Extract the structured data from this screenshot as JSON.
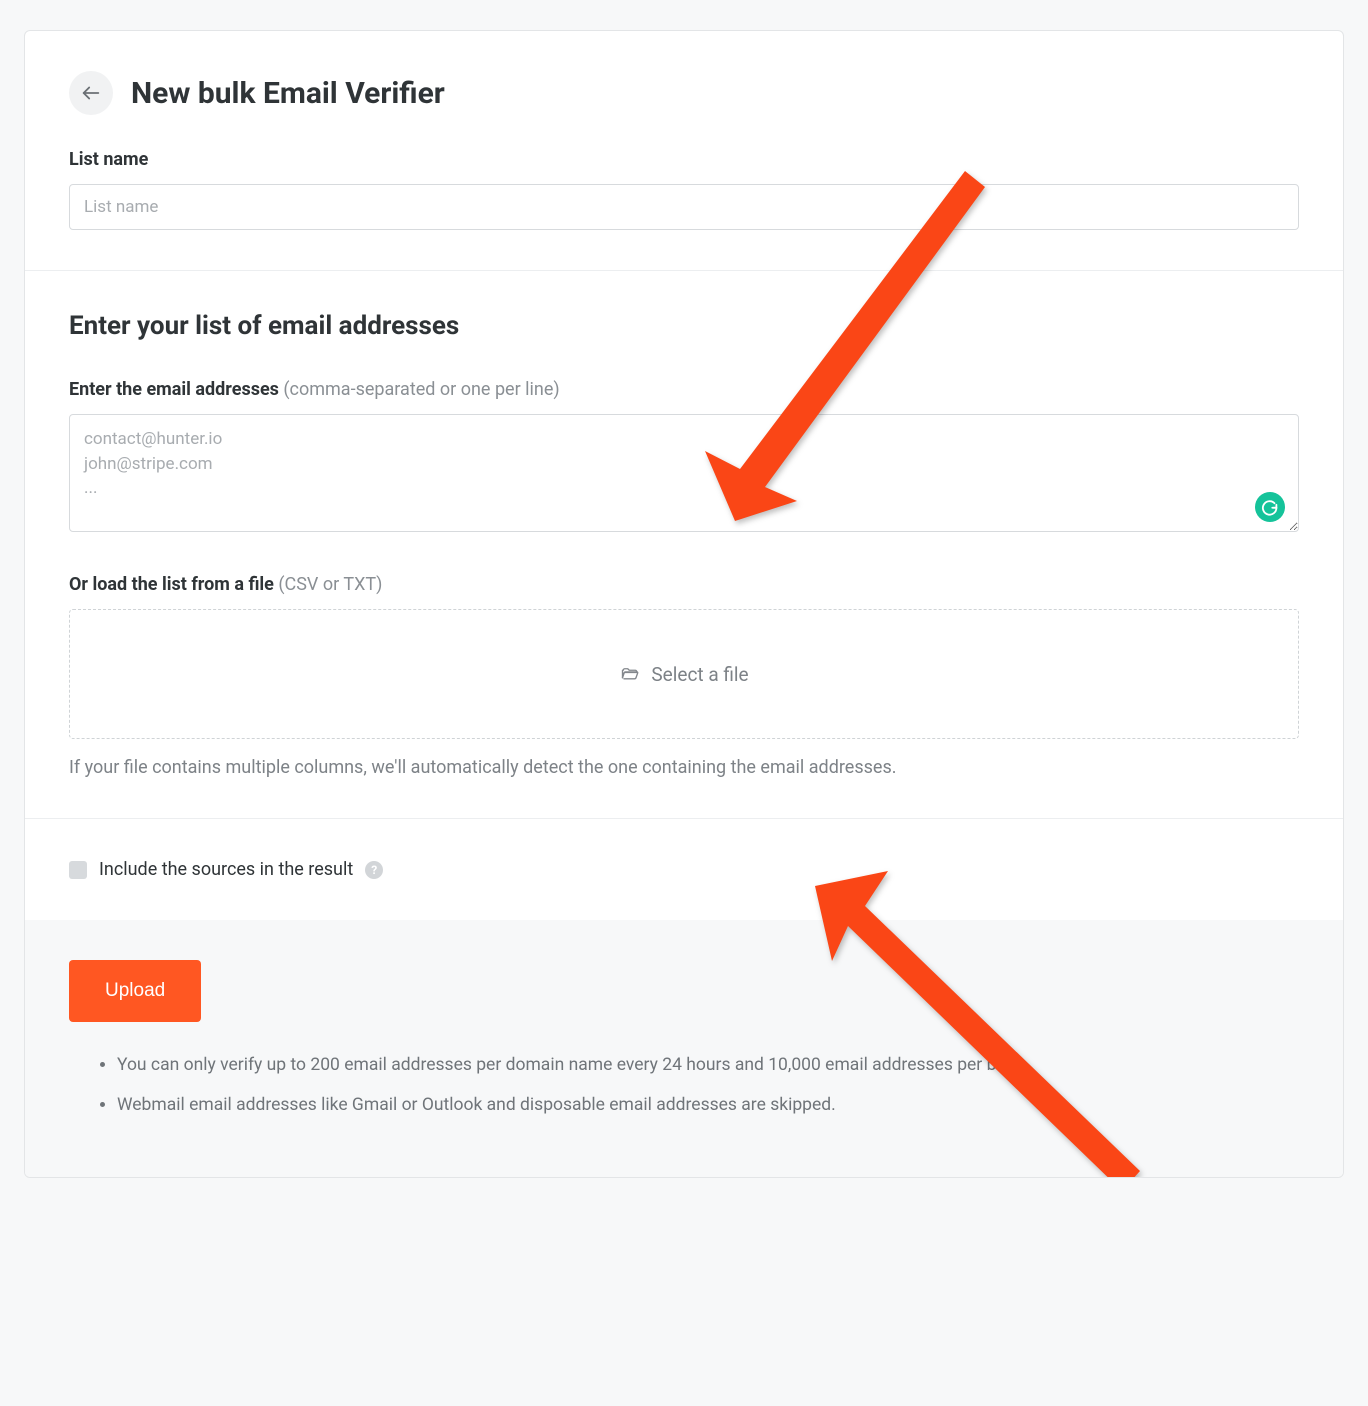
{
  "header": {
    "title": "New bulk Email Verifier"
  },
  "listName": {
    "label": "List name",
    "placeholder": "List name"
  },
  "emailSection": {
    "title": "Enter your list of email addresses",
    "inputLabel": "Enter the email addresses",
    "inputHint": " (comma-separated or one per line)",
    "textareaPlaceholder": "contact@hunter.io\njohn@stripe.com\n...",
    "fileLabel": "Or load the list from a file",
    "fileHint": " (CSV or TXT)",
    "selectFile": "Select a file",
    "fileHelp": "If your file contains multiple columns, we'll automatically detect the one containing the email addresses."
  },
  "options": {
    "includeSources": "Include the sources in the result"
  },
  "footer": {
    "uploadLabel": "Upload",
    "notes": [
      "You can only verify up to 200 email addresses per domain name every 24 hours and 10,000 email addresses per bulk.",
      "Webmail email addresses like Gmail or Outlook and disposable email addresses are skipped."
    ]
  }
}
